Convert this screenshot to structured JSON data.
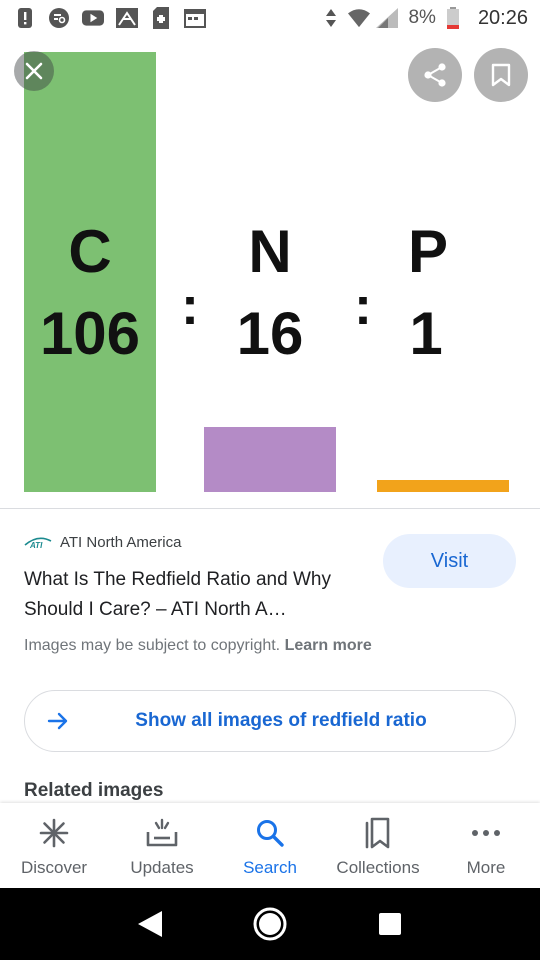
{
  "status_bar": {
    "battery_pct": "8%",
    "time": "20:26",
    "left_icons": [
      "alert-icon",
      "assistant-icon",
      "youtube-icon",
      "airmail-icon",
      "sim-icon",
      "calendar-icon"
    ]
  },
  "image": {
    "labels": [
      {
        "symbol": "C",
        "value": "106"
      },
      {
        "symbol": "N",
        "value": "16"
      },
      {
        "symbol": "P",
        "value": "1"
      }
    ],
    "separator": ":",
    "colors": {
      "c_bar": "#7dc072",
      "n_bar": "#b48bc6",
      "p_bar": "#f2a31b"
    },
    "bar_values": [
      106,
      16,
      1
    ]
  },
  "result": {
    "source": "ATI North America",
    "source_logo_text": "ATI",
    "title": "What Is The Redfield Ratio and Why Should I Care? – ATI North A…",
    "visit_label": "Visit",
    "copyright_text": "Images may be subject to copyright.",
    "learn_more": "Learn more",
    "show_all_label": "Show all images of redfield ratio",
    "related_heading": "Related images"
  },
  "bottom_nav": {
    "items": [
      {
        "label": "Discover",
        "icon": "asterisk-icon"
      },
      {
        "label": "Updates",
        "icon": "updates-icon"
      },
      {
        "label": "Search",
        "icon": "search-icon",
        "active": true
      },
      {
        "label": "Collections",
        "icon": "collections-icon"
      },
      {
        "label": "More",
        "icon": "more-icon"
      }
    ]
  },
  "accent_color": "#1a73e8"
}
